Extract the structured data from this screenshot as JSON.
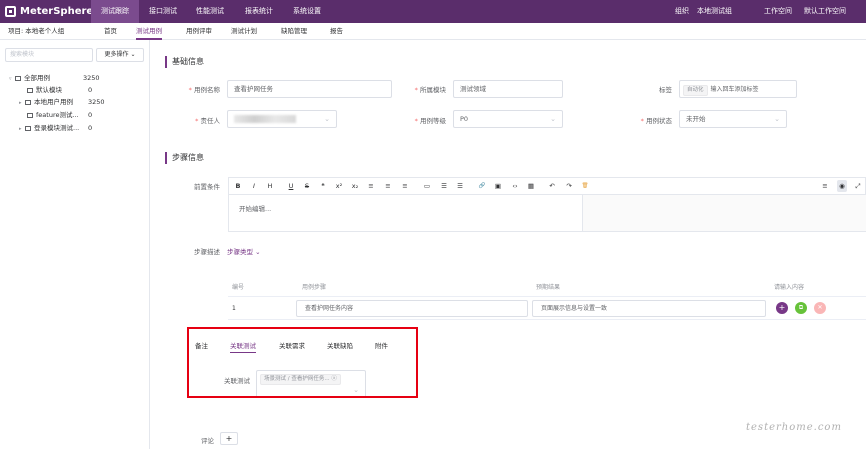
{
  "topbar": {
    "brand": "MeterSphere",
    "nav": [
      "测试跟踪",
      "接口测试",
      "性能测试",
      "报表统计",
      "系统设置"
    ],
    "org_label": "组织",
    "org_value": "本地测试组",
    "workspace_label": "工作空间",
    "workspace_value": "默认工作空间"
  },
  "subnav": {
    "project": "项目: 本地老个人组",
    "items": [
      "首页",
      "测试用例",
      "用例评审",
      "测试计划",
      "缺陷管理",
      "报告"
    ]
  },
  "sidebar": {
    "search_placeholder": "搜索模块",
    "more_button": "更多操作",
    "tree": [
      {
        "label": "全部用例",
        "count": "3250"
      },
      {
        "label": "默认模块",
        "count": "0"
      },
      {
        "label": "本地用户用例",
        "count": "3250"
      },
      {
        "label": "feature测试...",
        "count": "0"
      },
      {
        "label": "登录模块测试...",
        "count": "0"
      }
    ]
  },
  "basic_info": {
    "title": "基础信息",
    "case_name_label": "用例名称",
    "case_name_value": "查看护网任务",
    "module_label": "所属模块",
    "module_value": "测试领域",
    "tag_label": "标签",
    "tag_chip": "自动化",
    "tag_placeholder": "输入回车添加标签",
    "owner_label": "责任人",
    "priority_label": "用例等级",
    "priority_value": "P0",
    "status_label": "用例状态",
    "status_value": "未开始"
  },
  "step_info": {
    "title": "步骤信息",
    "precondition_label": "前置条件",
    "precondition_placeholder": "开始编辑...",
    "step_desc_label": "步骤描述",
    "step_desc_value": "步骤类型",
    "toolbar_icons": [
      "B",
      "I",
      "H",
      "U",
      "S",
      "❝",
      "x²",
      "x₂",
      "≡",
      "≡",
      "≡",
      "▭",
      "☰",
      "☰",
      "🔗",
      "▣",
      "‹›",
      "▦",
      "↶",
      "↷",
      "🗑"
    ],
    "toolbar_right_icons": [
      "≡",
      "◉",
      "⤢"
    ]
  },
  "steps_table": {
    "headers": [
      "编号",
      "用例步骤",
      "预期结果",
      "请输入内容"
    ],
    "rows": [
      {
        "num": "1",
        "step": "查看护网任务内容",
        "expected": "页面展示信息与设置一致"
      }
    ]
  },
  "bottom_tabs": {
    "items": [
      "备注",
      "关联测试",
      "关联需求",
      "关联缺陷",
      "附件"
    ],
    "active": "关联测试",
    "related_label": "关联测试",
    "related_value": "场景测试 / 查看护网任务..."
  },
  "footer": {
    "comment_label": "评论"
  },
  "watermark": "testerhome.com",
  "colors": {
    "topbar": "#5a2d6b",
    "accent": "#783887",
    "highlight_box": "#e60012"
  }
}
